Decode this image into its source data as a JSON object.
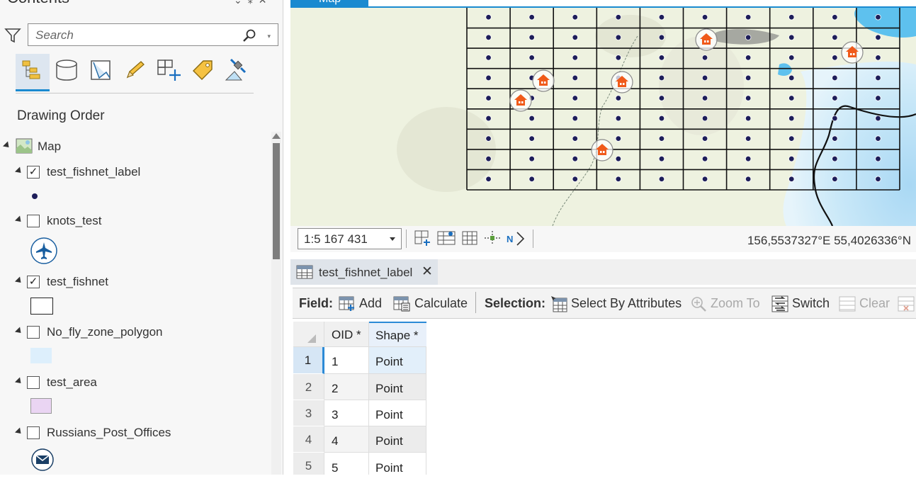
{
  "contents": {
    "title": "Contents",
    "search_placeholder": "Search",
    "drawing_order": "Drawing Order",
    "map_label": "Map",
    "layers": [
      {
        "name": "test_fishnet_label",
        "checked": "✓",
        "symbol": "dot"
      },
      {
        "name": "knots_test",
        "checked": "",
        "symbol": "airplane"
      },
      {
        "name": "test_fishnet",
        "checked": "✓",
        "symbol": "rectangle"
      },
      {
        "name": "No_fly_zone_polygon",
        "checked": "",
        "symbol": "light-blue-fill"
      },
      {
        "name": "test_area",
        "checked": "",
        "symbol": "pink-fill"
      },
      {
        "name": "Russians_Post_Offices",
        "checked": "",
        "symbol": "envelope"
      }
    ]
  },
  "map": {
    "tab_label": "Map",
    "scale": "1:5 167 431",
    "coordinates": "156,5537327°E 55,4026336°N",
    "accent_color": "#1a8ad0",
    "grid_color": "#111111",
    "point_color": "#1e1e5a",
    "marker_color": "#f05a1a"
  },
  "table": {
    "tab_label": "test_fishnet_label",
    "field_label": "Field:",
    "add_label": "Add",
    "calculate_label": "Calculate",
    "selection_label": "Selection:",
    "select_by_attributes_label": "Select By Attributes",
    "zoom_to_label": "Zoom To",
    "switch_label": "Switch",
    "clear_label": "Clear",
    "columns": [
      "OID *",
      "Shape *"
    ],
    "rows": [
      {
        "num": "1",
        "oid": "1",
        "shape": "Point"
      },
      {
        "num": "2",
        "oid": "2",
        "shape": "Point"
      },
      {
        "num": "3",
        "oid": "3",
        "shape": "Point"
      },
      {
        "num": "4",
        "oid": "4",
        "shape": "Point"
      },
      {
        "num": "5",
        "oid": "5",
        "shape": "Point"
      }
    ]
  }
}
